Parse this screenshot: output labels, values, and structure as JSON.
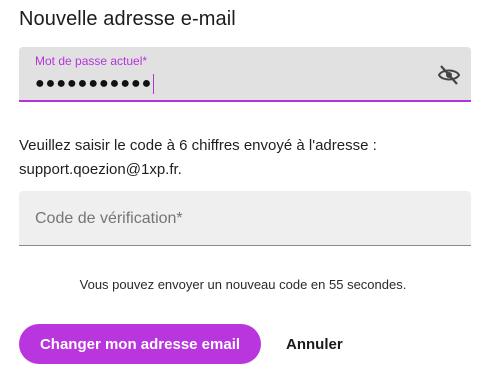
{
  "dialog": {
    "title": "Nouvelle adresse e-mail"
  },
  "password_field": {
    "label": "Mot de passe actuel*",
    "value": "●●●●●●●●●●●",
    "visibility_icon": "eye-off-icon"
  },
  "instructions": {
    "line1": "Veuillez saisir le code à 6 chiffres envoyé à l'adresse :",
    "email": "support.qoezion@1xp.fr."
  },
  "code_field": {
    "placeholder": "Code de vérification*",
    "value": ""
  },
  "resend": {
    "text": "Vous pouvez envoyer un nouveau code en 55 secondes."
  },
  "actions": {
    "primary_label": "Changer mon adresse email",
    "secondary_label": "Annuler"
  },
  "colors": {
    "accent": "#b935dd",
    "field_bg": "#e1e1e1",
    "text": "#1f1f1f"
  }
}
